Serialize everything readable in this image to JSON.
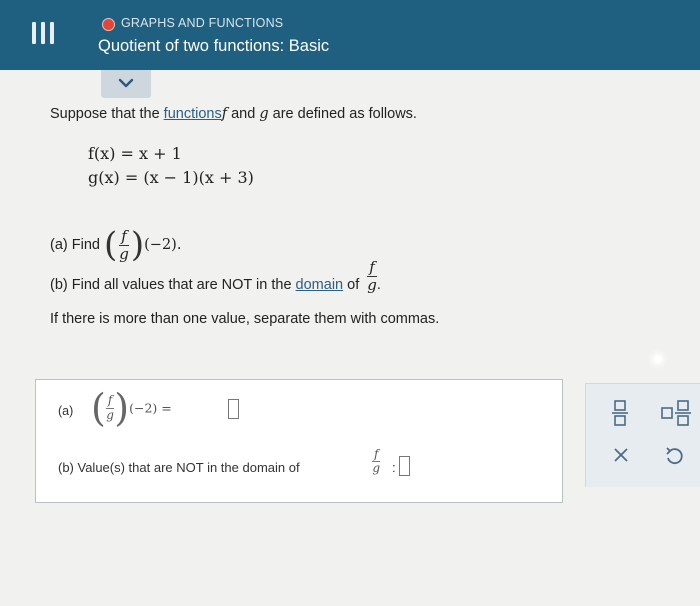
{
  "header": {
    "topic": "GRAPHS AND FUNCTIONS",
    "title": "Quotient of two functions: Basic",
    "topic_dot_color": "#e2463a",
    "background_color": "#1f5f7f"
  },
  "question": {
    "intro_before": "Suppose that the ",
    "intro_link": "functions",
    "intro_f": "f",
    "intro_and": " and ",
    "intro_g": "g",
    "intro_after": " are defined as follows.",
    "f_def": "f(x) = x + 1",
    "g_def": "g(x) = (x − 1)(x + 3)",
    "part_a_label": "(a) Find",
    "part_a_arg": "(−2).",
    "part_b_before": "(b) Find all values that are NOT in the ",
    "part_b_link": "domain",
    "part_b_after": " of",
    "instructions": "If there is more than one value, separate them with commas.",
    "frac_num": "f",
    "frac_den": "g"
  },
  "answer": {
    "a_label": "(a)",
    "a_arg": "(−2) =",
    "a_value": "",
    "b_label": "(b) Value(s) that are NOT in the domain of",
    "b_colon": ":",
    "b_value": ""
  },
  "toolbar": {
    "icons": [
      "fraction-icon",
      "mixed-number-icon",
      "clear-icon",
      "undo-icon"
    ]
  }
}
